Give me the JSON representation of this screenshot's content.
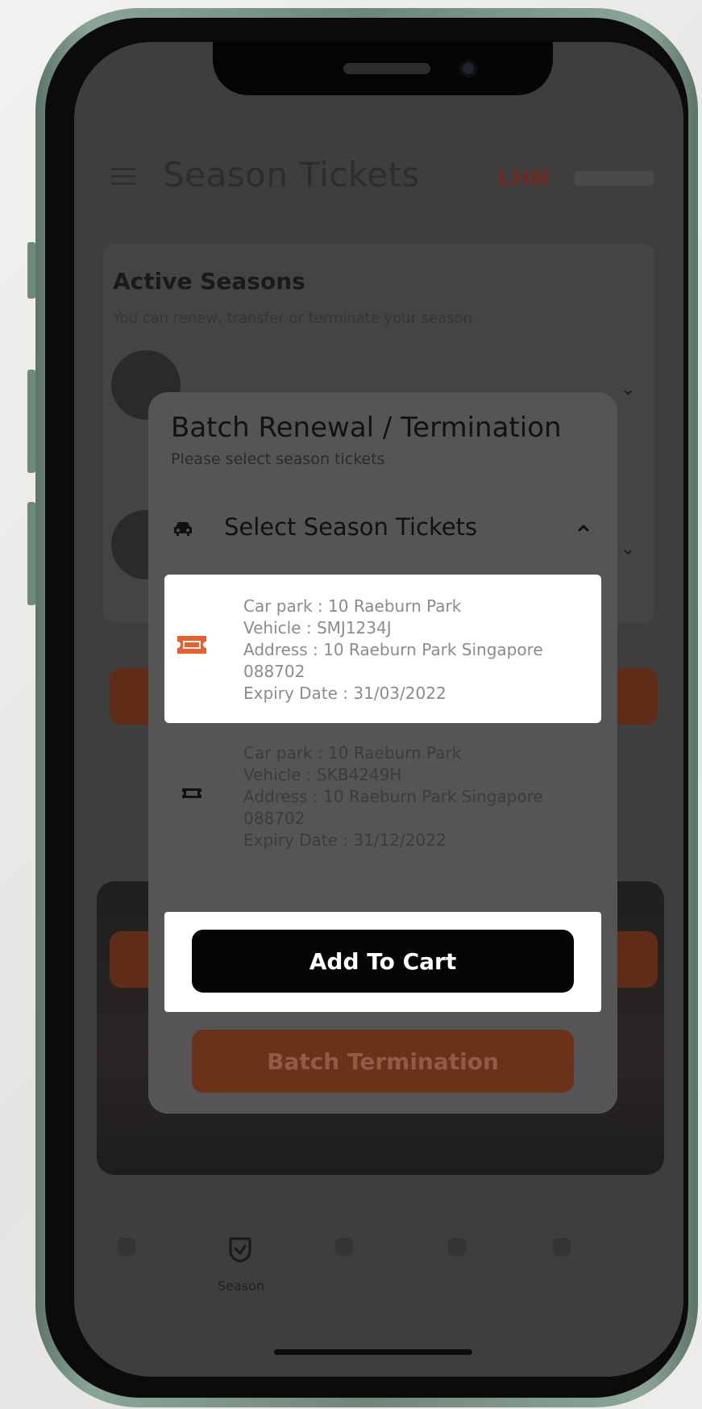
{
  "header": {
    "title": "Season Tickets",
    "logo_text": "LHN"
  },
  "active_seasons": {
    "title": "Active Seasons",
    "subtitle": "You can renew, transfer or terminate your season"
  },
  "modal": {
    "title": "Batch Renewal / Termination",
    "subtitle": "Please select season tickets",
    "section_label": "Select Season Tickets",
    "tickets": [
      {
        "car_park": "Car park : 10 Raeburn Park",
        "vehicle": "Vehicle : SMJ1234J",
        "address_line1": "Address : 10 Raeburn Park Singapore",
        "address_line2": "088702",
        "expiry": "Expiry Date : 31/03/2022",
        "selected": true,
        "icon": "ticket-icon",
        "icon_color": "#e8602c"
      },
      {
        "car_park": "Car park : 10 Raeburn Park",
        "vehicle": "Vehicle : SKB4249H",
        "address_line1": "Address : 10 Raeburn Park Singapore",
        "address_line2": "088702",
        "expiry": "Expiry Date : 31/12/2022",
        "selected": false,
        "icon": "ticket-icon",
        "icon_color": "#1a1a1a"
      }
    ],
    "add_to_cart_label": "Add To Cart",
    "batch_termination_label": "Batch Termination"
  },
  "bottom_nav": {
    "items": [
      {
        "icon": "home-icon",
        "label": ""
      },
      {
        "icon": "season-icon",
        "label": "Season"
      },
      {
        "icon": "parking-icon",
        "label": ""
      },
      {
        "icon": "cart-icon",
        "label": ""
      },
      {
        "icon": "profile-icon",
        "label": ""
      }
    ]
  },
  "colors": {
    "accent": "#e8602c",
    "overlay": "#3e3e3e",
    "primary_button": "#050505"
  }
}
